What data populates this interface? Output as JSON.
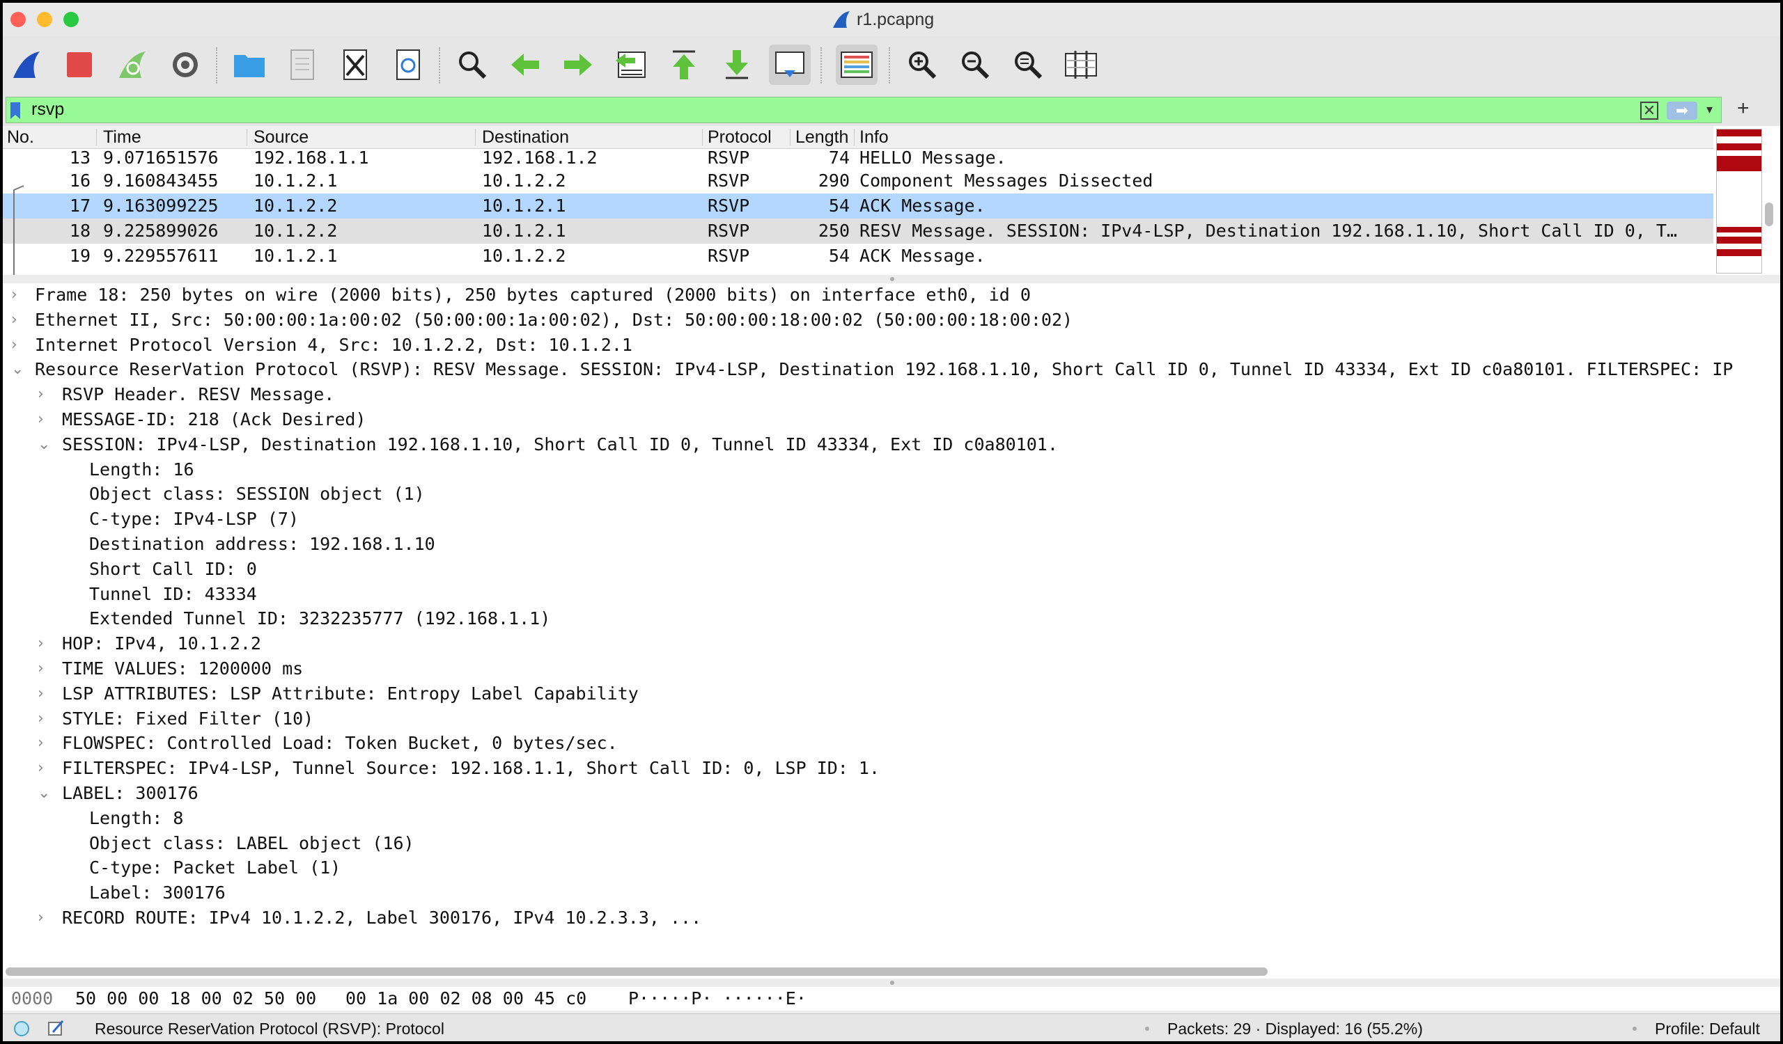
{
  "window": {
    "title": "r1.pcapng"
  },
  "toolbar": {
    "buttons": [
      {
        "name": "start-capture-icon",
        "glyph": "shark"
      },
      {
        "name": "stop-capture-icon",
        "glyph": "stop"
      },
      {
        "name": "restart-capture-icon",
        "glyph": "restart"
      },
      {
        "name": "capture-options-icon",
        "glyph": "gear"
      },
      {
        "name": "open-file-icon",
        "glyph": "folder"
      },
      {
        "name": "save-file-icon",
        "glyph": "file"
      },
      {
        "name": "close-file-icon",
        "glyph": "close-file"
      },
      {
        "name": "reload-file-icon",
        "glyph": "reload"
      },
      {
        "name": "find-packet-icon",
        "glyph": "search"
      },
      {
        "name": "go-back-icon",
        "glyph": "arrow-left"
      },
      {
        "name": "go-forward-icon",
        "glyph": "arrow-right"
      },
      {
        "name": "go-to-packet-icon",
        "glyph": "goto"
      },
      {
        "name": "first-packet-icon",
        "glyph": "arrow-up"
      },
      {
        "name": "last-packet-icon",
        "glyph": "arrow-down"
      },
      {
        "name": "autoscroll-icon",
        "glyph": "autoscroll"
      },
      {
        "name": "colorize-icon",
        "glyph": "colorize"
      },
      {
        "name": "zoom-in-icon",
        "glyph": "zoom-in"
      },
      {
        "name": "zoom-out-icon",
        "glyph": "zoom-out"
      },
      {
        "name": "normal-size-icon",
        "glyph": "zoom-normal"
      },
      {
        "name": "resize-columns-icon",
        "glyph": "columns"
      }
    ]
  },
  "filter": {
    "value": "rsvp",
    "clear_glyph": "✕",
    "apply_glyph": "➡",
    "dropdown_glyph": "▾",
    "add_glyph": "+"
  },
  "packet_list": {
    "columns": [
      "No.",
      "Time",
      "Source",
      "Destination",
      "Protocol",
      "Length",
      "Info"
    ],
    "rows": [
      {
        "no": "13",
        "time": "9.071651576",
        "source": "192.168.1.1",
        "destination": "192.168.1.2",
        "protocol": "RSVP",
        "length": "74",
        "info": "HELLO Message."
      },
      {
        "no": "16",
        "time": "9.160843455",
        "source": "10.1.2.1",
        "destination": "10.1.2.2",
        "protocol": "RSVP",
        "length": "290",
        "info": "Component Messages Dissected"
      },
      {
        "no": "17",
        "time": "9.163099225",
        "source": "10.1.2.2",
        "destination": "10.1.2.1",
        "protocol": "RSVP",
        "length": "54",
        "info": "ACK Message."
      },
      {
        "no": "18",
        "time": "9.225899026",
        "source": "10.1.2.2",
        "destination": "10.1.2.1",
        "protocol": "RSVP",
        "length": "250",
        "info": "RESV Message. SESSION: IPv4-LSP, Destination 192.168.1.10, Short Call ID 0, T…"
      },
      {
        "no": "19",
        "time": "9.229557611",
        "source": "10.1.2.1",
        "destination": "10.1.2.2",
        "protocol": "RSVP",
        "length": "54",
        "info": "ACK Message."
      }
    ]
  },
  "details": {
    "lines": [
      {
        "chev": "›",
        "text": "Frame 18: 250 bytes on wire (2000 bits), 250 bytes captured (2000 bits) on interface eth0, id 0"
      },
      {
        "chev": "›",
        "text": "Ethernet II, Src: 50:00:00:1a:00:02 (50:00:00:1a:00:02), Dst: 50:00:00:18:00:02 (50:00:00:18:00:02)"
      },
      {
        "chev": "›",
        "text": "Internet Protocol Version 4, Src: 10.1.2.2, Dst: 10.1.2.1"
      },
      {
        "chev": "⌄",
        "text": "Resource ReserVation Protocol (RSVP): RESV Message. SESSION: IPv4-LSP, Destination 192.168.1.10, Short Call ID 0, Tunnel ID 43334, Ext ID c0a80101. FILTERSPEC: IP"
      },
      {
        "chev": "›",
        "text": "RSVP Header. RESV Message."
      },
      {
        "chev": "›",
        "text": "MESSAGE-ID: 218 (Ack Desired)"
      },
      {
        "chev": "⌄",
        "text": "SESSION: IPv4-LSP, Destination 192.168.1.10, Short Call ID 0, Tunnel ID 43334, Ext ID c0a80101."
      },
      {
        "chev": "",
        "text": "Length: 16"
      },
      {
        "chev": "",
        "text": "Object class: SESSION object (1)"
      },
      {
        "chev": "",
        "text": "C-type: IPv4-LSP (7)"
      },
      {
        "chev": "",
        "text": "Destination address: 192.168.1.10"
      },
      {
        "chev": "",
        "text": "Short Call ID: 0"
      },
      {
        "chev": "",
        "text": "Tunnel ID: 43334"
      },
      {
        "chev": "",
        "text": "Extended Tunnel ID: 3232235777 (192.168.1.1)"
      },
      {
        "chev": "›",
        "text": "HOP: IPv4, 10.1.2.2"
      },
      {
        "chev": "›",
        "text": "TIME VALUES: 1200000 ms"
      },
      {
        "chev": "›",
        "text": "LSP ATTRIBUTES: LSP Attribute: Entropy Label Capability"
      },
      {
        "chev": "›",
        "text": "STYLE: Fixed Filter (10)"
      },
      {
        "chev": "›",
        "text": "FLOWSPEC: Controlled Load: Token Bucket, 0 bytes/sec."
      },
      {
        "chev": "›",
        "text": "FILTERSPEC: IPv4-LSP, Tunnel Source: 192.168.1.1, Short Call ID: 0, LSP ID: 1."
      },
      {
        "chev": "⌄",
        "text": "LABEL: 300176"
      },
      {
        "chev": "",
        "text": "Length: 8"
      },
      {
        "chev": "",
        "text": "Object class: LABEL object (16)"
      },
      {
        "chev": "",
        "text": "C-type: Packet Label (1)"
      },
      {
        "chev": "",
        "text": "Label: 300176"
      },
      {
        "chev": "›",
        "text": "RECORD ROUTE: IPv4 10.1.2.2, Label 300176, IPv4 10.2.3.3, ..."
      }
    ]
  },
  "bytes": {
    "offset": "0000",
    "hex1": "50 00 00 18 00 02 50 00",
    "hex2": "00 1a 00 02 08 00 45 c0",
    "ascii": "P·····P· ······E·"
  },
  "status": {
    "field": "Resource ReserVation Protocol (RSVP): Protocol",
    "packets": "Packets: 29 · Displayed: 16 (55.2%)",
    "profile": "Profile: Default"
  }
}
